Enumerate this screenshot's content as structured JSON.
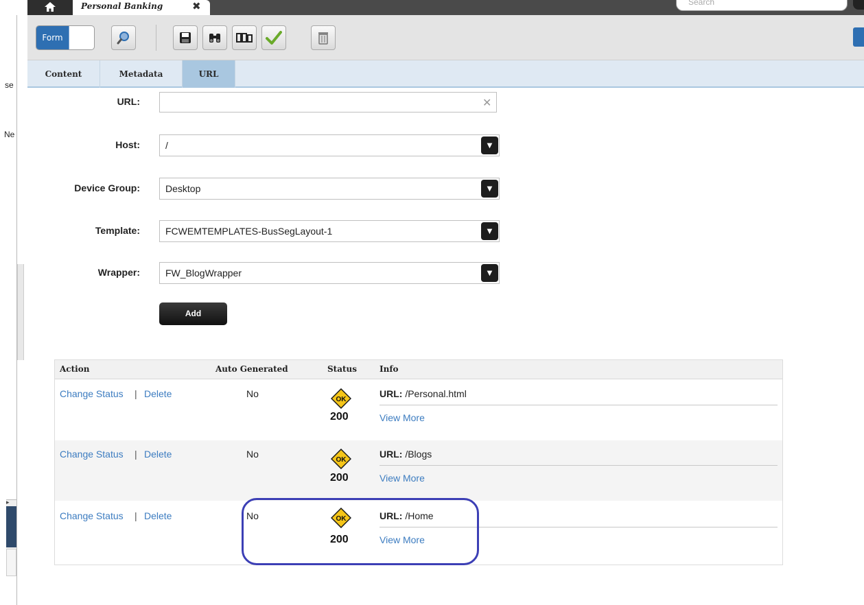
{
  "app": {
    "tab_title": "Personal Banking",
    "search_placeholder": "Search"
  },
  "left_panel": {
    "text1": "se",
    "text2": "Ne"
  },
  "toolbar": {
    "form_label": "Form"
  },
  "tabs": [
    {
      "label": "Content",
      "active": false
    },
    {
      "label": "Metadata",
      "active": false
    },
    {
      "label": "URL",
      "active": true
    }
  ],
  "form": {
    "url": {
      "label": "URL:",
      "value": ""
    },
    "host": {
      "label": "Host:",
      "value": "/"
    },
    "device_group": {
      "label": "Device Group:",
      "value": "Desktop"
    },
    "template": {
      "label": "Template:",
      "value": "FCWEMTEMPLATES-BusSegLayout-1"
    },
    "wrapper": {
      "label": "Wrapper:",
      "value": "FW_BlogWrapper"
    },
    "add_label": "Add"
  },
  "table": {
    "headers": {
      "action": "Action",
      "auto_generated": "Auto Generated",
      "status": "Status",
      "info": "Info"
    },
    "action_separator": "|",
    "rows": [
      {
        "change_status": "Change Status",
        "delete": "Delete",
        "auto_generated": "No",
        "badge": "OK",
        "status_code": "200",
        "url_prefix": "URL:",
        "url": "/Personal.html",
        "view_more": "View More"
      },
      {
        "change_status": "Change Status",
        "delete": "Delete",
        "auto_generated": "No",
        "badge": "OK",
        "status_code": "200",
        "url_prefix": "URL:",
        "url": "/Blogs",
        "view_more": "View More"
      },
      {
        "change_status": "Change Status",
        "delete": "Delete",
        "auto_generated": "No",
        "badge": "OK",
        "status_code": "200",
        "url_prefix": "URL:",
        "url": "/Home",
        "view_more": "View More"
      }
    ]
  },
  "colors": {
    "accent_blue": "#2e6fb2",
    "link": "#3c7cc0",
    "highlight": "#3c3fb5",
    "ok_badge": "#f5c518"
  }
}
